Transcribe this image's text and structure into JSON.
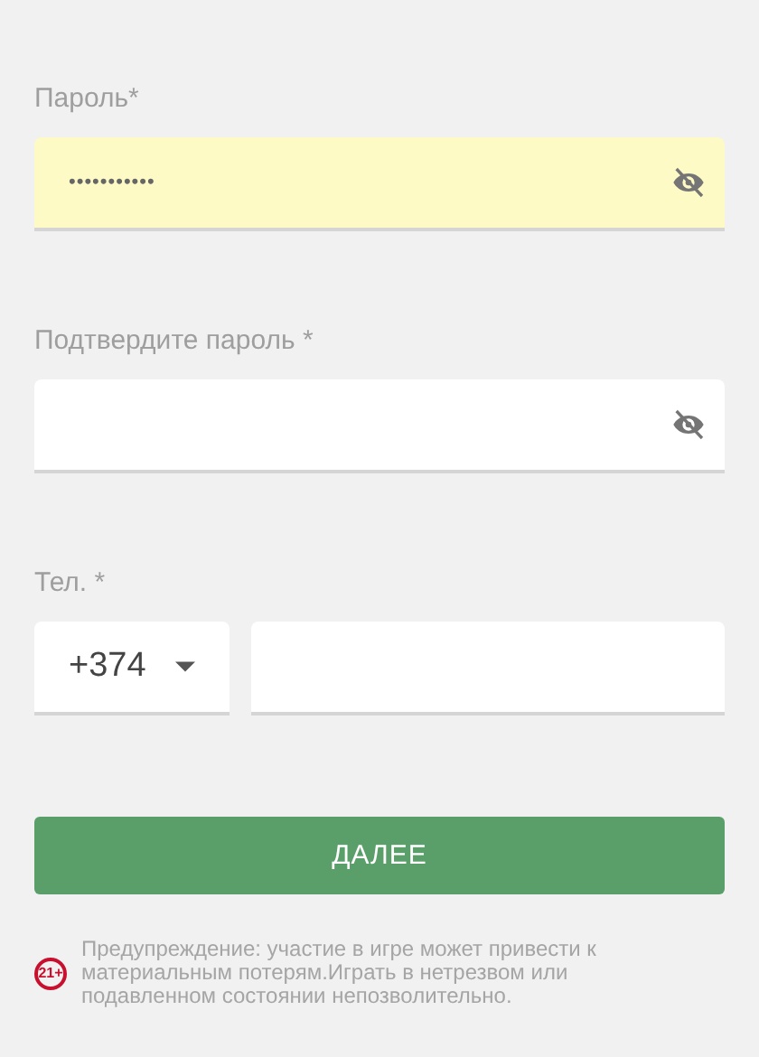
{
  "fields": [
    {
      "kind": "password",
      "label": "Пароль*",
      "value": "•••••••••••",
      "autofilled": true
    },
    {
      "kind": "password",
      "label": "Подтвердите пароль *",
      "autofilled": false
    },
    {
      "kind": "phone",
      "label": "Тел. *",
      "code": "+374"
    }
  ],
  "button": "ДАЛЕЕ",
  "warning": {
    "badge": "21+",
    "text": "Предупреждение: участие в игре может привести к материальным потерям.Играть в нетрезвом или подавленном состоянии непозволительно."
  }
}
